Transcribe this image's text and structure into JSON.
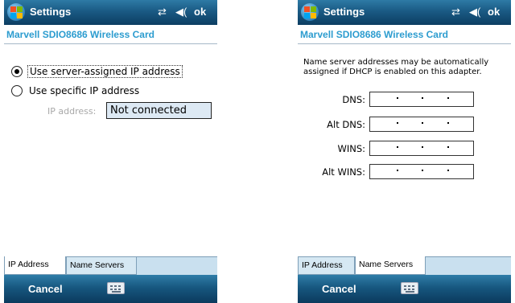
{
  "screens": [
    {
      "title": "Settings",
      "ok": "ok",
      "header": "Marvell SDIO8686 Wireless Card",
      "options": [
        {
          "label": "Use server-assigned IP address",
          "selected": true
        },
        {
          "label": "Use specific IP address",
          "selected": false
        }
      ],
      "ip_label": "IP address:",
      "ip_value": "Not connected",
      "tabs": [
        "IP Address",
        "Name Servers"
      ],
      "active_tab": 0,
      "softkey_left": "Cancel"
    },
    {
      "title": "Settings",
      "ok": "ok",
      "header": "Marvell SDIO8686 Wireless Card",
      "info": "Name server addresses may be automatically assigned if DHCP is enabled on this adapter.",
      "fields": [
        {
          "label": "DNS:"
        },
        {
          "label": "Alt DNS:"
        },
        {
          "label": "WINS:"
        },
        {
          "label": "Alt WINS:"
        }
      ],
      "tabs": [
        "IP Address",
        "Name Servers"
      ],
      "active_tab": 1,
      "softkey_left": "Cancel"
    }
  ],
  "icons": {
    "start": "windows-flag-icon",
    "connectivity": "connectivity-icon",
    "volume": "speaker-icon",
    "keyboard": "keyboard-icon"
  },
  "colors": {
    "title_bar": "#1a5a84",
    "header_text": "#2c9ccf",
    "ip_box_fill": "#dde9f4",
    "tab_strip": "#c9e0ef"
  }
}
